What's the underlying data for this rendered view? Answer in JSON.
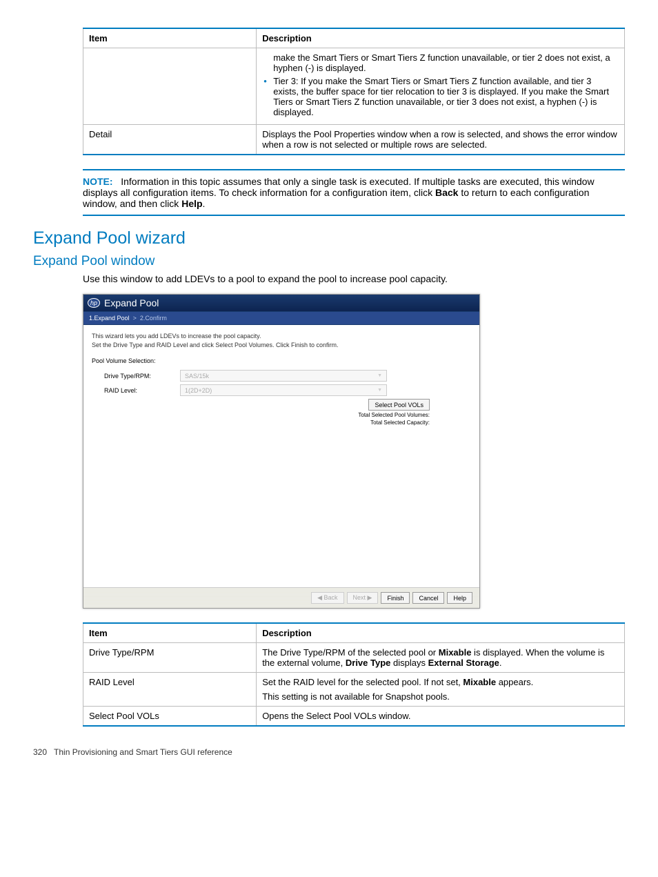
{
  "table1": {
    "headers": {
      "item": "Item",
      "desc": "Description"
    },
    "row0": {
      "item": "",
      "desc_pre": "make the Smart Tiers or Smart Tiers Z function unavailable, or tier 2 does not exist, a hyphen (-) is displayed.",
      "bullet1": "Tier 3: If you make the Smart Tiers or Smart Tiers Z function available, and tier 3 exists, the buffer space for tier relocation to tier 3 is displayed. If you make the Smart Tiers or Smart Tiers Z function unavailable, or tier 3 does not exist, a hyphen (-) is displayed."
    },
    "row1": {
      "item": "Detail",
      "desc": "Displays the Pool Properties window when a row is selected, and shows the error window when a row is not selected or multiple rows are selected."
    }
  },
  "note": {
    "label": "NOTE:",
    "text_pre": "Information in this topic assumes that only a single task is executed. If multiple tasks are executed, this window displays all configuration items. To check information for a configuration item, click ",
    "text_back": "Back",
    "text_mid": " to return to each configuration window, and then click ",
    "text_help": "Help",
    "text_end": "."
  },
  "headings": {
    "h1": "Expand Pool wizard",
    "h2": "Expand Pool window",
    "intro": "Use this window to add LDEVs to a pool to expand the pool to increase pool capacity."
  },
  "wizard": {
    "title": "Expand Pool",
    "step1": "1.Expand Pool",
    "sep": ">",
    "step2": "2.Confirm",
    "intro1": "This wizard lets you add LDEVs to increase the pool capacity.",
    "intro2": "Set the Drive Type and RAID Level and click Select Pool Volumes. Click Finish to confirm.",
    "section_label": "Pool Volume Selection:",
    "drive_label": "Drive Type/RPM:",
    "drive_value": "SAS/15k",
    "raid_label": "RAID Level:",
    "raid_value": "1(2D+2D)",
    "select_btn": "Select Pool VOLs",
    "total_vol_label": "Total Selected Pool Volumes:",
    "total_cap_label": "Total Selected Capacity:",
    "btn_back": "◀ Back",
    "btn_next": "Next ▶",
    "btn_finish": "Finish",
    "btn_cancel": "Cancel",
    "btn_help": "Help"
  },
  "table2": {
    "headers": {
      "item": "Item",
      "desc": "Description"
    },
    "rows": [
      {
        "item": "Drive Type/RPM",
        "desc_pre": "The Drive Type/RPM of the selected pool or ",
        "b1": "Mixable",
        "desc_mid": " is displayed. When the volume is the external volume, ",
        "b2": "Drive Type",
        "desc_mid2": " displays ",
        "b3": "External Storage",
        "desc_end": "."
      },
      {
        "item": "RAID Level",
        "desc_pre": "Set the RAID level for the selected pool. If not set, ",
        "b1": "Mixable",
        "desc_mid": " appears.",
        "line2": "This setting is not available for Snapshot pools."
      },
      {
        "item": "Select Pool VOLs",
        "desc": "Opens the Select Pool VOLs window."
      }
    ]
  },
  "footer": {
    "page": "320",
    "title": "Thin Provisioning and Smart Tiers GUI reference"
  }
}
